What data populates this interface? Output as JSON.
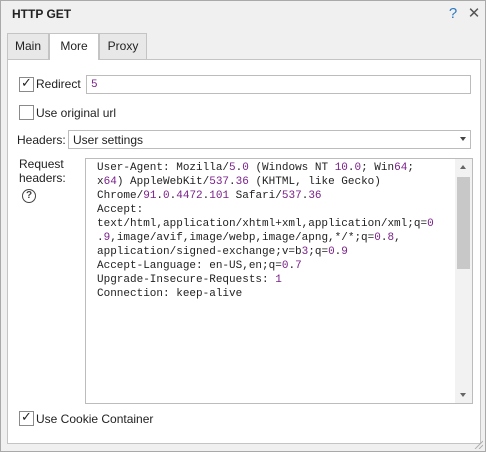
{
  "window": {
    "title": "HTTP GET",
    "help_glyph": "?",
    "close_glyph": "✕"
  },
  "tabs": [
    {
      "label": "Main"
    },
    {
      "label": "More"
    },
    {
      "label": "Proxy"
    }
  ],
  "redirect": {
    "label": "Redirect",
    "checked": true,
    "value": "5"
  },
  "original_url": {
    "label": "Use original url",
    "checked": false
  },
  "headers": {
    "label": "Headers:",
    "selected": "User settings"
  },
  "request_headers": {
    "label_line1": "Request",
    "label_line2": "headers:",
    "help_glyph": "?",
    "lines": [
      "User-Agent: Mozilla/5.0 (Windows NT 10.0; Win64;",
      "x64) AppleWebKit/537.36 (KHTML, like Gecko)",
      "Chrome/91.0.4472.101 Safari/537.36",
      "Accept:",
      "text/html,application/xhtml+xml,application/xml;q=0",
      ".9,image/avif,image/webp,image/apng,*/*;q=0.8,",
      "application/signed-exchange;v=b3;q=0.9",
      "Accept-Language: en-US,en;q=0.7",
      "Upgrade-Insecure-Requests: 1",
      "Connection: keep-alive"
    ]
  },
  "cookie_container": {
    "label": "Use Cookie Container",
    "checked": true
  },
  "colors": {
    "number_highlight": "#7a1f8a",
    "help_blue": "#2b79c2"
  }
}
